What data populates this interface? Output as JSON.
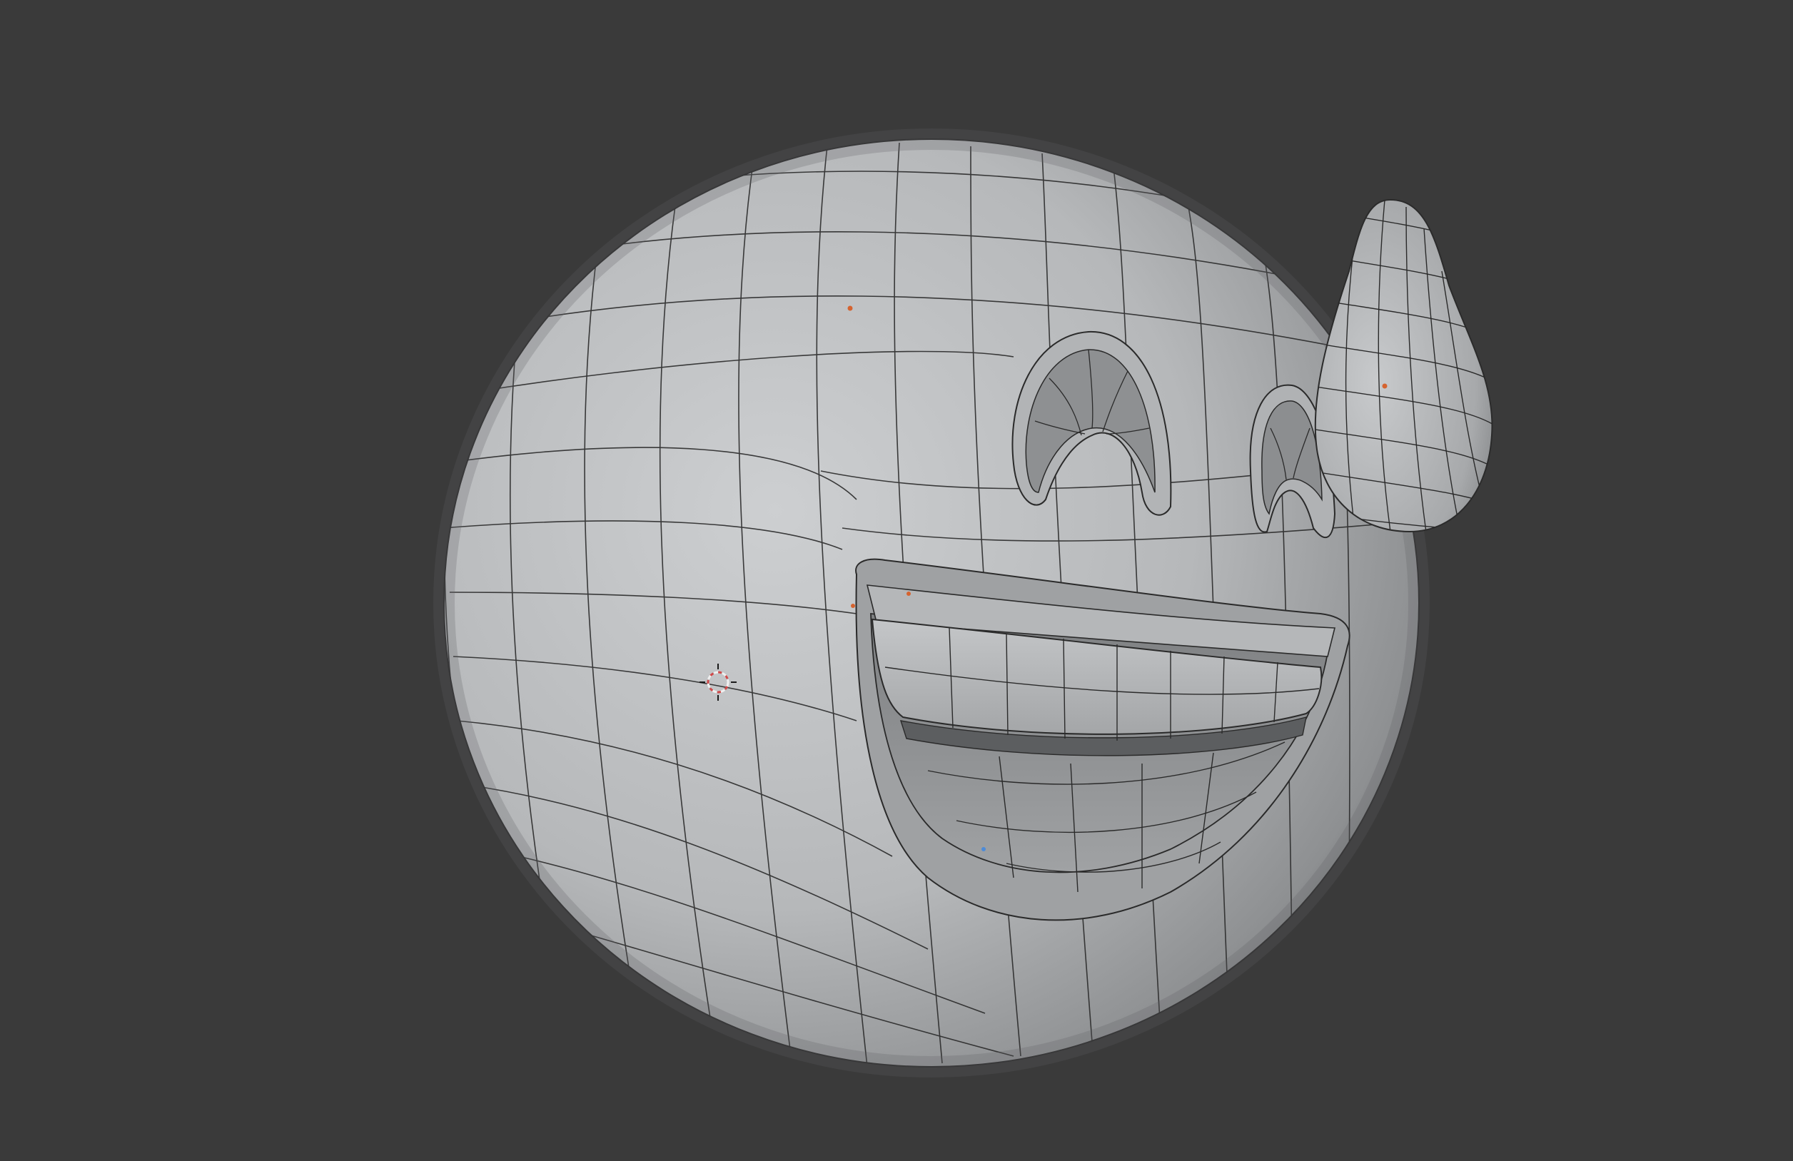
{
  "app": {
    "type": "3d-viewport",
    "mode": "object",
    "shading": "solid",
    "overlay": "wireframe"
  },
  "colors": {
    "background": "#3a3a3a",
    "mesh_light": "#c9cbcd",
    "mesh_mid": "#a9abad",
    "mesh_dark": "#6f7173",
    "wire": "#2a2a2a",
    "origin_dot": "#d5632f",
    "selected_vertex": "#4d8bd8",
    "cursor_red": "#d04a4a",
    "cursor_white": "#f0f0f0"
  },
  "icons": {
    "scene_cursor": "3d-cursor-icon",
    "object_origin": "object-origin-icon"
  },
  "objects": [
    {
      "name": "emoji-head",
      "kind": "sphere-mesh"
    },
    {
      "name": "sweat-drop",
      "kind": "teardrop-mesh"
    }
  ]
}
